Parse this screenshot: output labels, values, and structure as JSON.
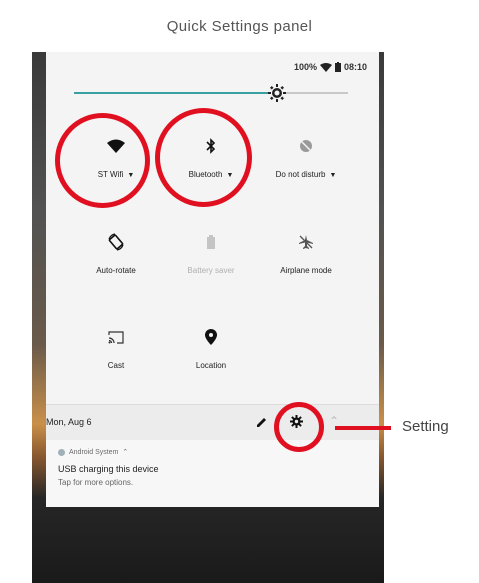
{
  "caption": "Quick Settings panel",
  "status": {
    "battery": "100%",
    "time": "08:10"
  },
  "brightness": {
    "level": 0.74
  },
  "tiles": [
    {
      "id": "wifi",
      "label": "ST Wifi",
      "dropdown": true,
      "icon": "wifi-icon",
      "dim": false
    },
    {
      "id": "bluetooth",
      "label": "Bluetooth",
      "dropdown": true,
      "icon": "bluetooth-icon",
      "dim": false
    },
    {
      "id": "dnd",
      "label": "Do not disturb",
      "dropdown": true,
      "icon": "do-not-disturb-icon",
      "dim": false
    },
    {
      "id": "rotate",
      "label": "Auto-rotate",
      "dropdown": false,
      "icon": "auto-rotate-icon",
      "dim": false
    },
    {
      "id": "battery",
      "label": "Battery saver",
      "dropdown": false,
      "icon": "battery-saver-icon",
      "dim": true
    },
    {
      "id": "airplane",
      "label": "Airplane mode",
      "dropdown": false,
      "icon": "airplane-mode-icon",
      "dim": false
    },
    {
      "id": "cast",
      "label": "Cast",
      "dropdown": false,
      "icon": "cast-icon",
      "dim": false
    },
    {
      "id": "location",
      "label": "Location",
      "dropdown": false,
      "icon": "location-icon",
      "dim": false
    }
  ],
  "footer": {
    "date": "Mon, Aug 6"
  },
  "notification": {
    "app": "Android System",
    "title": "USB charging this device",
    "subtitle": "Tap for more options."
  },
  "callout": {
    "label": "Setting"
  },
  "colors": {
    "annotation": "#e01020",
    "accent": "#38a0a0",
    "panel": "#f4f4f4"
  }
}
